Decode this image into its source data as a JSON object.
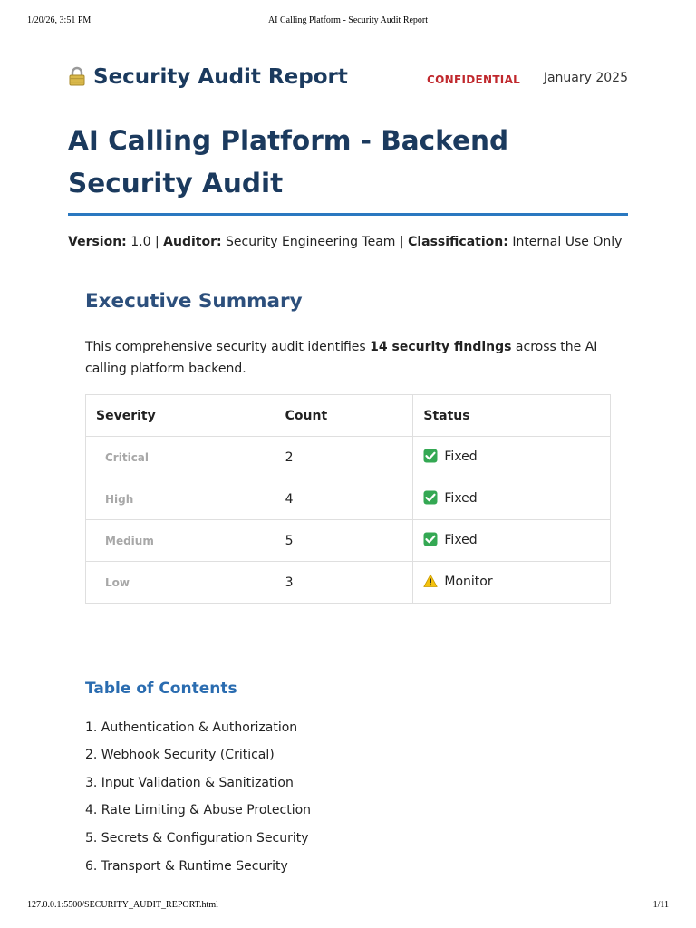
{
  "print_header": {
    "datetime": "1/20/26, 3:51 PM",
    "page_title": "AI Calling Platform - Security Audit Report"
  },
  "print_footer": {
    "url": "127.0.0.1:5500/SECURITY_AUDIT_REPORT.html",
    "page": "1/11"
  },
  "brand": {
    "icon": "lock-icon",
    "title": "Security Audit Report",
    "confidential_label": "CONFIDENTIAL",
    "date": "January 2025"
  },
  "document": {
    "title": "AI Calling Platform - Backend Security Audit"
  },
  "meta": {
    "version_label": "Version:",
    "version_value": "1.0",
    "auditor_label": "Auditor:",
    "auditor_value": "Security Engineering Team",
    "classification_label": "Classification:",
    "classification_value": "Internal Use Only",
    "separator": "|"
  },
  "executive_summary": {
    "heading": "Executive Summary",
    "text_before": "This comprehensive security audit identifies ",
    "text_bold": "14 security findings",
    "text_after": " across the AI calling platform backend."
  },
  "severity_table": {
    "headers": [
      "Severity",
      "Count",
      "Status"
    ],
    "rows": [
      {
        "severity": "Critical",
        "count": "2",
        "status": "Fixed",
        "status_icon": "check-icon"
      },
      {
        "severity": "High",
        "count": "4",
        "status": "Fixed",
        "status_icon": "check-icon"
      },
      {
        "severity": "Medium",
        "count": "5",
        "status": "Fixed",
        "status_icon": "check-icon"
      },
      {
        "severity": "Low",
        "count": "3",
        "status": "Monitor",
        "status_icon": "warning-icon"
      }
    ]
  },
  "toc": {
    "heading": "Table of Contents",
    "items": [
      "1. Authentication & Authorization",
      "2. Webhook Security (Critical)",
      "3. Input Validation & Sanitization",
      "4. Rate Limiting & Abuse Protection",
      "5. Secrets & Configuration Security",
      "6. Transport & Runtime Security"
    ]
  },
  "colors": {
    "heading_navy": "#1b3a5e",
    "section_blue": "#2c4f7c",
    "toc_blue": "#2a6cb0",
    "rule_blue": "#2a78c0",
    "confidential_red": "#c0282d",
    "check_green": "#34a853",
    "warning_yellow": "#f4c20d"
  }
}
